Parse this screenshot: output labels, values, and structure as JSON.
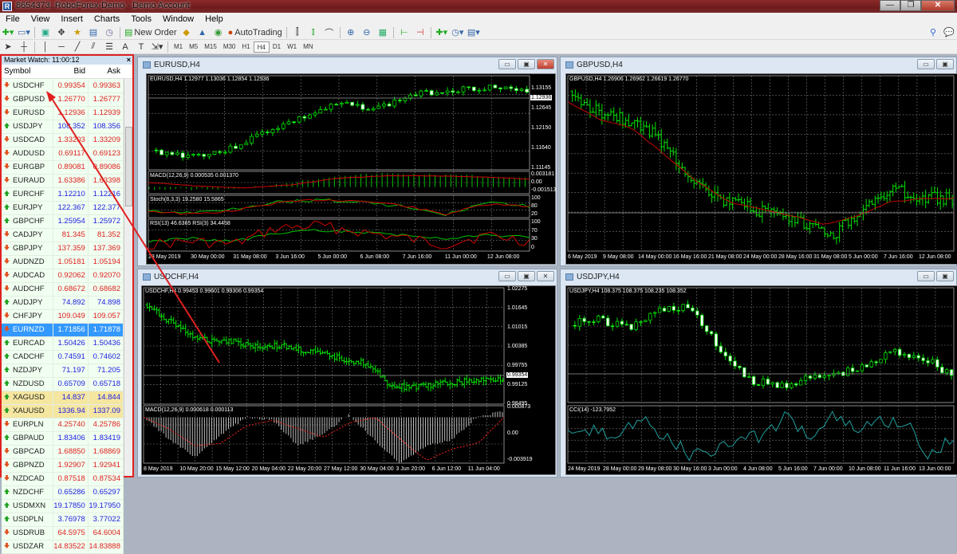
{
  "window": {
    "title": "8654373: RoboForex-Demo - Demo Account",
    "icon": "app-icon",
    "min": "—",
    "max": "❐",
    "close": "✕"
  },
  "menu": [
    "File",
    "View",
    "Insert",
    "Charts",
    "Tools",
    "Window",
    "Help"
  ],
  "toolbar1": {
    "new_order": "New Order",
    "auto_trading": "AutoTrading"
  },
  "timeframes": [
    "M1",
    "M5",
    "M15",
    "M30",
    "H1",
    "H4",
    "D1",
    "W1",
    "MN"
  ],
  "active_timeframe": "H4",
  "market_watch": {
    "title": "Market Watch: 11:00:12",
    "columns": [
      "Symbol",
      "Bid",
      "Ask"
    ],
    "rows": [
      {
        "symbol": "USDCHF",
        "bid": "0.99354",
        "ask": "0.99363",
        "dir": "down"
      },
      {
        "symbol": "GBPUSD",
        "bid": "1.26770",
        "ask": "1.26777",
        "dir": "down"
      },
      {
        "symbol": "EURUSD",
        "bid": "1.12936",
        "ask": "1.12939",
        "dir": "down"
      },
      {
        "symbol": "USDJPY",
        "bid": "108.352",
        "ask": "108.356",
        "dir": "up"
      },
      {
        "symbol": "USDCAD",
        "bid": "1.33203",
        "ask": "1.33209",
        "dir": "down"
      },
      {
        "symbol": "AUDUSD",
        "bid": "0.69117",
        "ask": "0.69123",
        "dir": "down"
      },
      {
        "symbol": "EURGBP",
        "bid": "0.89081",
        "ask": "0.89086",
        "dir": "down"
      },
      {
        "symbol": "EURAUD",
        "bid": "1.63386",
        "ask": "1.63398",
        "dir": "down"
      },
      {
        "symbol": "EURCHF",
        "bid": "1.12210",
        "ask": "1.12216",
        "dir": "up"
      },
      {
        "symbol": "EURJPY",
        "bid": "122.367",
        "ask": "122.377",
        "dir": "up"
      },
      {
        "symbol": "GBPCHF",
        "bid": "1.25954",
        "ask": "1.25972",
        "dir": "up"
      },
      {
        "symbol": "CADJPY",
        "bid": "81.345",
        "ask": "81.352",
        "dir": "down"
      },
      {
        "symbol": "GBPJPY",
        "bid": "137.359",
        "ask": "137.369",
        "dir": "down"
      },
      {
        "symbol": "AUDNZD",
        "bid": "1.05181",
        "ask": "1.05194",
        "dir": "down"
      },
      {
        "symbol": "AUDCAD",
        "bid": "0.92062",
        "ask": "0.92070",
        "dir": "down"
      },
      {
        "symbol": "AUDCHF",
        "bid": "0.68672",
        "ask": "0.68682",
        "dir": "down"
      },
      {
        "symbol": "AUDJPY",
        "bid": "74.892",
        "ask": "74.898",
        "dir": "up"
      },
      {
        "symbol": "CHFJPY",
        "bid": "109.049",
        "ask": "109.057",
        "dir": "down"
      },
      {
        "symbol": "EURNZD",
        "bid": "1.71856",
        "ask": "1.71878",
        "dir": "down",
        "selected": true
      },
      {
        "symbol": "EURCAD",
        "bid": "1.50426",
        "ask": "1.50436",
        "dir": "up"
      },
      {
        "symbol": "CADCHF",
        "bid": "0.74591",
        "ask": "0.74602",
        "dir": "up"
      },
      {
        "symbol": "NZDJPY",
        "bid": "71.197",
        "ask": "71.205",
        "dir": "up"
      },
      {
        "symbol": "NZDUSD",
        "bid": "0.65709",
        "ask": "0.65718",
        "dir": "up"
      },
      {
        "symbol": "XAGUSD",
        "bid": "14.837",
        "ask": "14.844",
        "dir": "up",
        "highlight": true
      },
      {
        "symbol": "XAUUSD",
        "bid": "1336.94",
        "ask": "1337.09",
        "dir": "up",
        "highlight": true
      },
      {
        "symbol": "EURPLN",
        "bid": "4.25740",
        "ask": "4.25786",
        "dir": "down"
      },
      {
        "symbol": "GBPAUD",
        "bid": "1.83406",
        "ask": "1.83419",
        "dir": "up"
      },
      {
        "symbol": "GBPCAD",
        "bid": "1.68850",
        "ask": "1.68869",
        "dir": "down"
      },
      {
        "symbol": "GBPNZD",
        "bid": "1.92907",
        "ask": "1.92941",
        "dir": "down"
      },
      {
        "symbol": "NZDCAD",
        "bid": "0.87518",
        "ask": "0.87534",
        "dir": "down"
      },
      {
        "symbol": "NZDCHF",
        "bid": "0.65286",
        "ask": "0.65297",
        "dir": "up"
      },
      {
        "symbol": "USDMXN",
        "bid": "19.17850",
        "ask": "19.17950",
        "dir": "up"
      },
      {
        "symbol": "USDPLN",
        "bid": "3.76978",
        "ask": "3.77022",
        "dir": "up"
      },
      {
        "symbol": "USDRUB",
        "bid": "64.5975",
        "ask": "64.6004",
        "dir": "down"
      },
      {
        "symbol": "USDZAR",
        "bid": "14.83522",
        "ask": "14.83888",
        "dir": "down"
      }
    ]
  },
  "charts": {
    "eurusd": {
      "title": "EURUSD,H4",
      "ohlc_label": "EURUSD,H4  1.12977 1.13036 1.12854 1.12936",
      "price_axis": [
        "1.13155",
        "1.12645",
        "1.12150",
        "1.11640",
        "1.11145"
      ],
      "current_price": "1.12936",
      "macd_label": "MACD(12,26,9) 0.000535 0.001370",
      "macd_axis": [
        "0.003181",
        "0.00",
        "-0.001513"
      ],
      "stoch_label": "Stoch(8,3,3) 19.2580 15.5865",
      "stoch_axis": [
        "100",
        "80",
        "20"
      ],
      "rsi_label": "RSI(13) 46.6365  RSI(3) 34.4458",
      "rsi_axis": [
        "100",
        "70",
        "30",
        "0"
      ],
      "time_axis": [
        "28 May 2019",
        "30 May 00:00",
        "31 May 08:00",
        "3 Jun 16:00",
        "5 Jun 00:00",
        "6 Jun 08:00",
        "7 Jun 16:00",
        "11 Jun 00:00",
        "12 Jun 08:00"
      ]
    },
    "gbpusd": {
      "title": "GBPUSD,H4",
      "ohlc_label": "GBPUSD,H4  1.26906 1.26962 1.26619 1.26770",
      "time_axis": [
        "6 May 2019",
        "9 May 08:00",
        "14 May 00:00",
        "16 May 16:00",
        "21 May 08:00",
        "24 May 00:00",
        "28 May 16:00",
        "31 May 08:00",
        "5 Jun 00:00",
        "7 Jun 16:00",
        "12 Jun 08:00"
      ]
    },
    "usdchf": {
      "title": "USDCHF,H4",
      "ohlc_label": "USDCHF,H4  0.99453 0.99601 0.99306 0.99354",
      "price_axis": [
        "1.02275",
        "1.01645",
        "1.01015",
        "1.00385",
        "0.99755",
        "0.99125",
        "0.98495"
      ],
      "current_price": "0.99354",
      "macd_label": "MACD(12,26,9) 0.000618 0.000113",
      "macd_axis": [
        "0.000873",
        "0.00",
        "-0.003919"
      ],
      "time_axis": [
        "8 May 2019",
        "10 May 20:00",
        "15 May 12:00",
        "20 May 04:00",
        "22 May 20:00",
        "27 May 12:00",
        "30 May 04:00",
        "3 Jun 20:00",
        "6 Jun 12:00",
        "11 Jun 04:00"
      ]
    },
    "usdjpy": {
      "title": "USDJPY,H4",
      "ohlc_label": "USDJPY,H4  108.375 108.375 108.235 108.352",
      "cci_label": "CCI(14) -123.7952",
      "time_axis": [
        "24 May 2019",
        "28 May 00:00",
        "29 May 08:00",
        "30 May 16:00",
        "3 Jun 00:00",
        "4 Jun 08:00",
        "5 Jun 16:00",
        "7 Jun 00:00",
        "10 Jun 08:00",
        "11 Jun 16:00",
        "13 Jun 00:00"
      ]
    }
  },
  "colors": {
    "bull": "#00ff00",
    "bear_body": "#ffffff",
    "ma": "#c00000",
    "signal": "#ff2020",
    "cci": "#20a0a0",
    "down": "#e02020",
    "up": "#2020e0",
    "annotation": "#e02020"
  }
}
